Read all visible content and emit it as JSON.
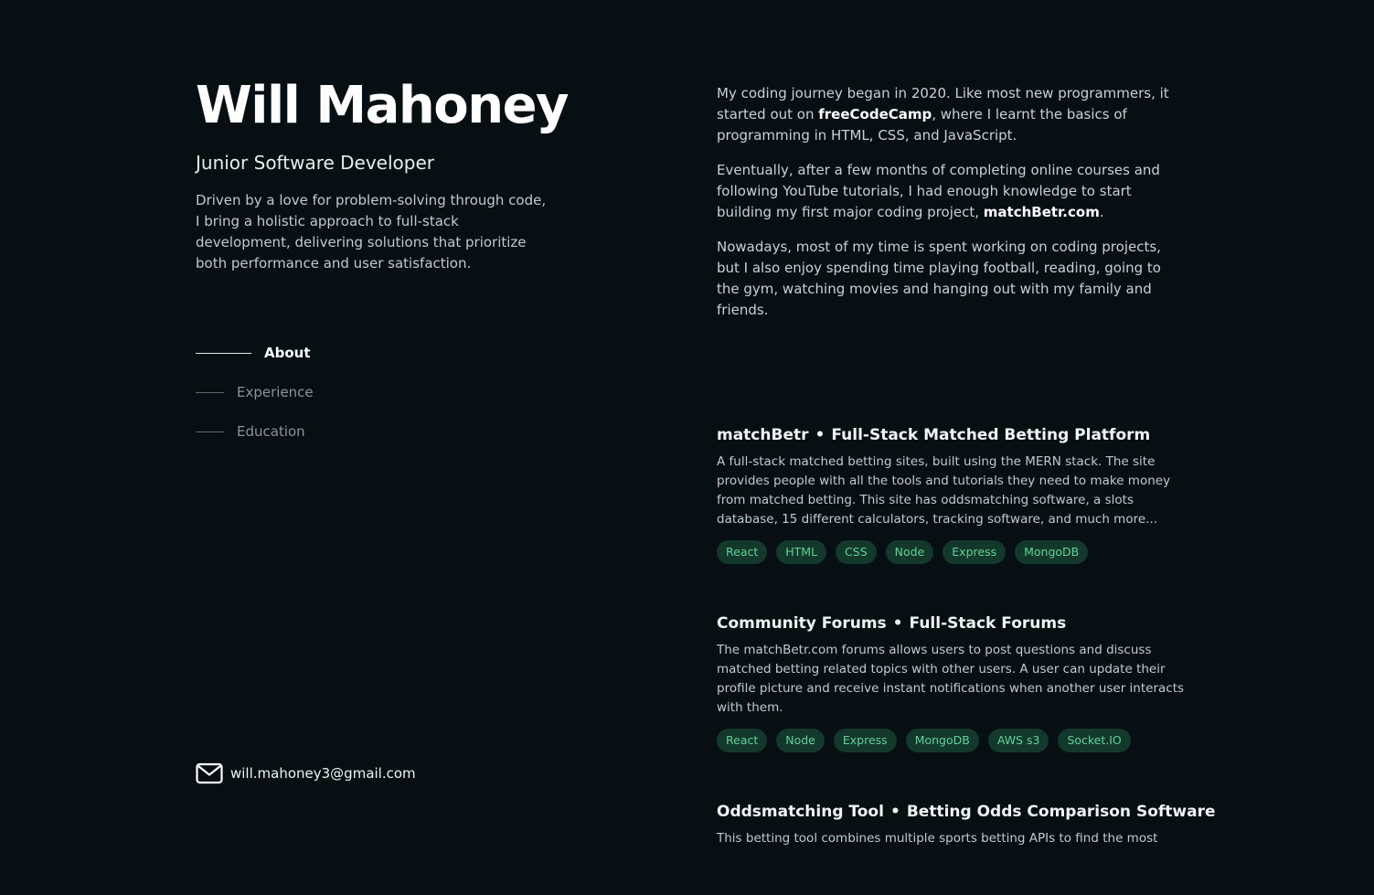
{
  "profile": {
    "name": "Will Mahoney",
    "role": "Junior Software Developer",
    "intro": "Driven by a love for problem-solving through code, I bring a holistic approach to full-stack development, delivering solutions that prioritize both performance and user satisfaction."
  },
  "nav": {
    "items": [
      {
        "label": "About",
        "active": true
      },
      {
        "label": "Experience",
        "active": false
      },
      {
        "label": "Education",
        "active": false
      }
    ]
  },
  "contact": {
    "email": "will.mahoney3@gmail.com",
    "icon": "mail-icon"
  },
  "about": {
    "p1_a": "My coding journey began in 2020. Like most new programmers, it started out on ",
    "p1_link": "freeCodeCamp",
    "p1_b": ", where I learnt the basics of programming in HTML, CSS, and JavaScript.",
    "p2_a": "Eventually, after a few months of completing online courses and following YouTube tutorials, I had enough knowledge to start building my first major coding project, ",
    "p2_link": "matchBetr.com",
    "p2_b": ".",
    "p3": "Nowadays, most of my time is spent working on coding projects, but I also enjoy spending time playing football, reading, going to the gym, watching movies and hanging out with my family and friends."
  },
  "projects": [
    {
      "name": "matchBetr",
      "subtitle": "Full-Stack Matched Betting Platform",
      "description": "A full-stack matched betting sites, built using the MERN stack. The site provides people with all the tools and tutorials they need to make money from matched betting. This site has oddsmatching software, a slots database, 15 different calculators, tracking software, and much more...",
      "tags": [
        "React",
        "HTML",
        "CSS",
        "Node",
        "Express",
        "MongoDB"
      ]
    },
    {
      "name": "Community Forums",
      "subtitle": "Full-Stack Forums",
      "description": "The matchBetr.com forums allows users to post questions and discuss matched betting related topics with other users. A user can update their profile picture and receive instant notifications when another user interacts with them.",
      "tags": [
        "React",
        "Node",
        "Express",
        "MongoDB",
        "AWS s3",
        "Socket.IO"
      ]
    },
    {
      "name": "Oddsmatching Tool",
      "subtitle": "Betting Odds Comparison Software",
      "description": "This betting tool combines multiple sports betting APIs to find the most",
      "tags": []
    }
  ],
  "separator": "•",
  "colors": {
    "background": "#070f12",
    "tag_background": "#13382c",
    "tag_text": "#5fd39a"
  }
}
